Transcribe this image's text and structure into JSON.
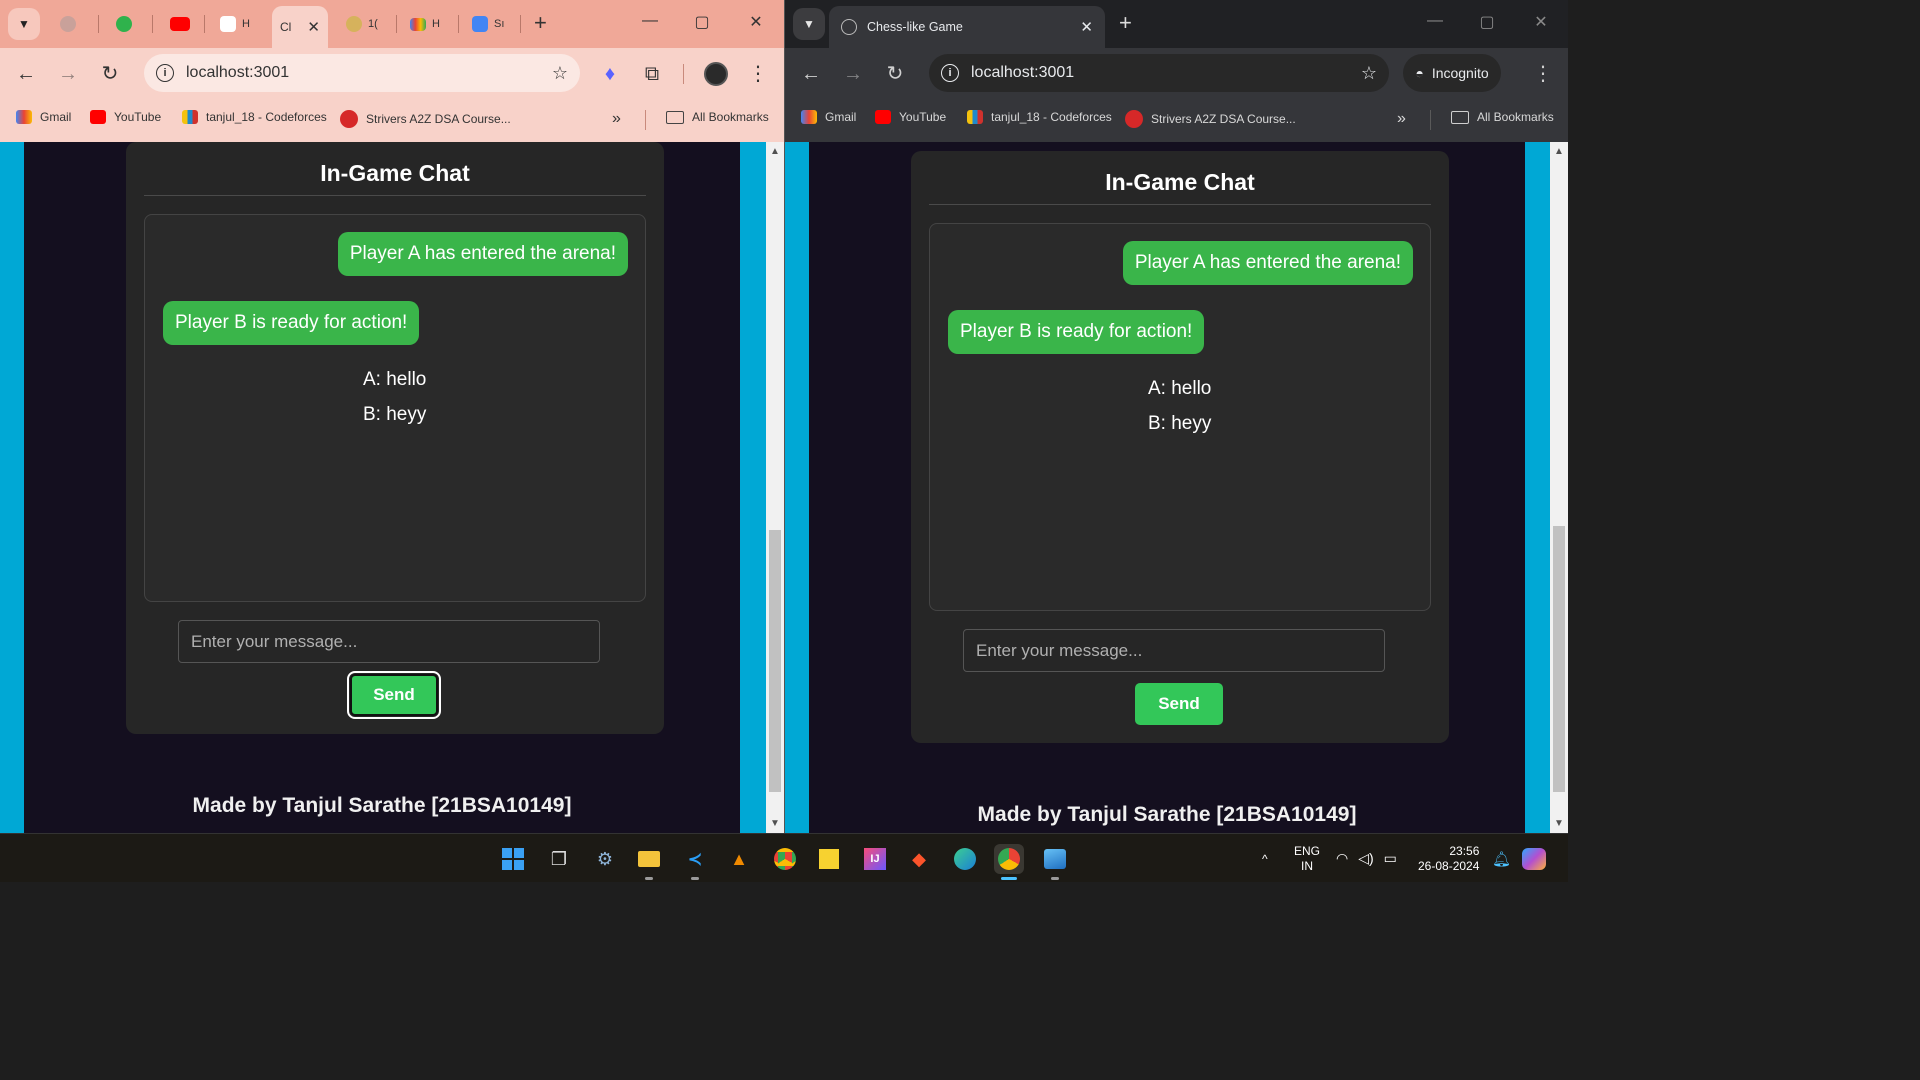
{
  "left_window": {
    "active_tab_label": "Cl",
    "mini_tabs": [
      "H",
      "1(",
      "H",
      "Sı"
    ],
    "url": "localhost:3001",
    "window_controls": [
      "—",
      "▢",
      "✕"
    ]
  },
  "right_window": {
    "active_tab_title": "Chess-like Game",
    "url": "localhost:3001",
    "incognito_label": "Incognito",
    "window_controls": [
      "—",
      "▢",
      "✕"
    ]
  },
  "bookmarks": {
    "items": [
      "Gmail",
      "YouTube",
      "tanjul_18 - Codeforces",
      "Strivers A2Z DSA Course..."
    ],
    "overflow": "»",
    "all_bookmarks": "All Bookmarks"
  },
  "chat": {
    "title": "In-Game Chat",
    "messages": [
      {
        "text": "Player A has entered the arena!",
        "style": "bubble-right"
      },
      {
        "text": "Player B is ready for action!",
        "style": "bubble-left"
      },
      {
        "text": "A: hello",
        "style": "plain"
      },
      {
        "text": "B: heyy",
        "style": "plain"
      }
    ],
    "input_placeholder": "Enter your message...",
    "send_label": "Send",
    "credit": "Made by Tanjul Sarathe [21BSA10149]"
  },
  "taskbar": {
    "lang_top": "ENG",
    "lang_bottom": "IN",
    "time": "23:56",
    "date": "26-08-2024",
    "tray_chevron": "^"
  },
  "colors": {
    "accent_green": "#3ab54a",
    "send_green": "#33c759",
    "page_side": "#00a8d5",
    "page_center": "#140f1f"
  }
}
